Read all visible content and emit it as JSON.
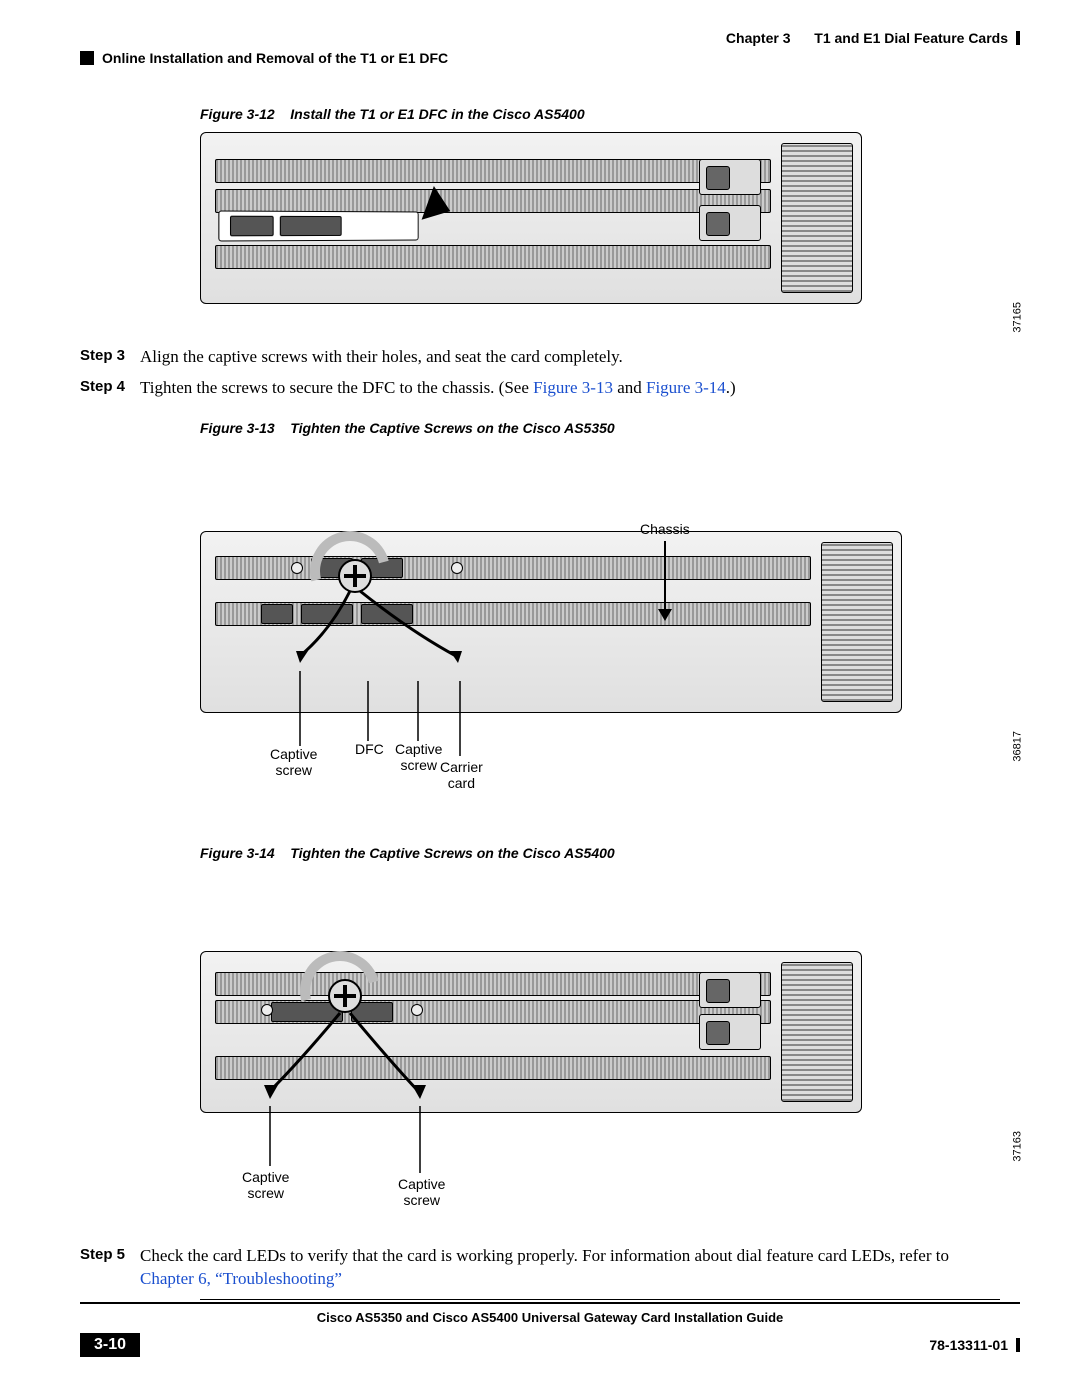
{
  "header": {
    "chapter_label": "Chapter 3",
    "chapter_title": "T1 and E1 Dial Feature Cards",
    "section_title": "Online Installation and Removal of the T1 or E1 DFC"
  },
  "figures": {
    "f12": {
      "label": "Figure 3-12",
      "title": "Install the T1 or E1 DFC in the Cisco AS5400",
      "image_id": "37165"
    },
    "f13": {
      "label": "Figure 3-13",
      "title": "Tighten the Captive Screws on the Cisco AS5350",
      "image_id": "36817",
      "callouts": {
        "chassis": "Chassis",
        "captive_screw_left": "Captive\nscrew",
        "dfc": "DFC",
        "captive_screw_mid": "Captive\nscrew",
        "carrier_card": "Carrier\ncard"
      }
    },
    "f14": {
      "label": "Figure 3-14",
      "title": "Tighten the Captive Screws on the Cisco AS5400",
      "image_id": "37163",
      "callouts": {
        "captive_screw_left": "Captive\nscrew",
        "captive_screw_right": "Captive\nscrew"
      }
    }
  },
  "steps": {
    "s3": {
      "label": "Step 3",
      "text": "Align the captive screws with their holes, and seat the card completely."
    },
    "s4": {
      "label": "Step 4",
      "text_before": "Tighten the screws to secure the DFC to the chassis. (See ",
      "link1": "Figure 3-13",
      "text_mid": " and ",
      "link2": "Figure 3-14",
      "text_after": ".)"
    },
    "s5": {
      "label": "Step 5",
      "text_before": "Check the card LEDs to verify that the card is working properly. For information about dial feature card LEDs, refer to ",
      "link": "Chapter 6, “Troubleshooting”"
    }
  },
  "footer": {
    "guide_title": "Cisco AS5350 and Cisco AS5400 Universal Gateway Card Installation Guide",
    "page_number": "3-10",
    "doc_number": "78-13311-01"
  }
}
